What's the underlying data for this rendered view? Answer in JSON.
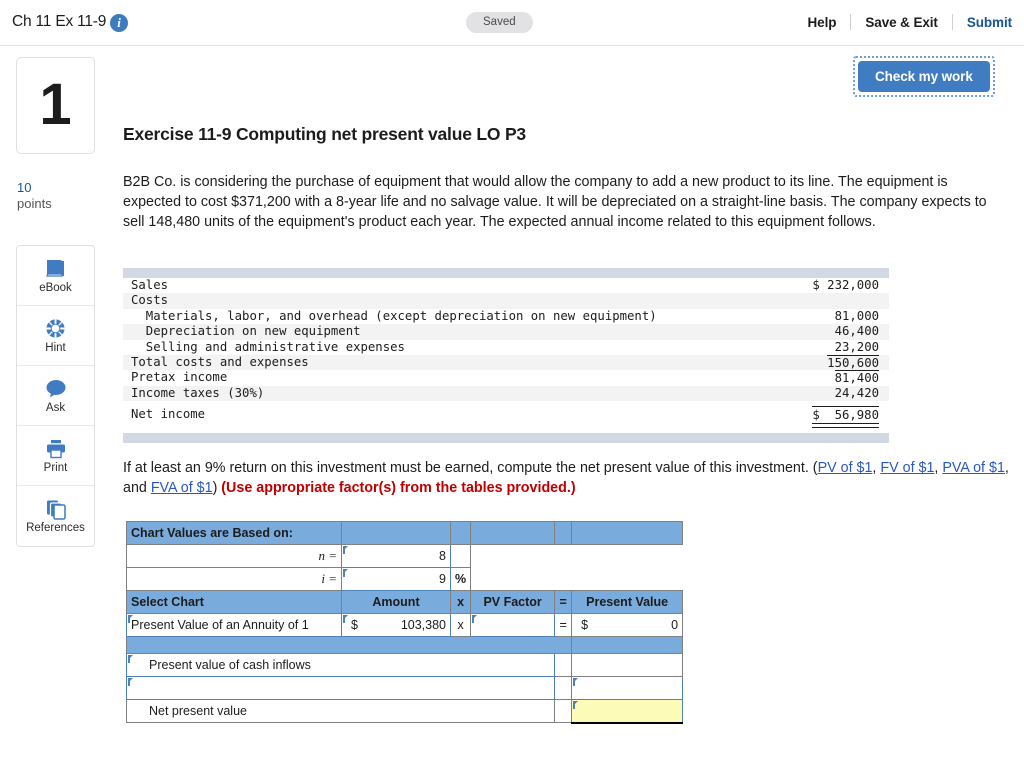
{
  "header": {
    "title": "Ch 11 Ex 11-9",
    "info_icon": "info-icon",
    "saved_status": "Saved",
    "help_label": "Help",
    "save_exit_label": "Save & Exit",
    "submit_label": "Submit"
  },
  "check_my_work": {
    "label": "Check my work"
  },
  "sidebar": {
    "question_number": "1",
    "points_value": "10",
    "points_label": "points",
    "tools": [
      {
        "label": "eBook",
        "icon": "book-icon"
      },
      {
        "label": "Hint",
        "icon": "lifebuoy-icon"
      },
      {
        "label": "Ask",
        "icon": "chat-bubble-icon"
      },
      {
        "label": "Print",
        "icon": "printer-icon"
      },
      {
        "label": "References",
        "icon": "copy-pages-icon"
      }
    ]
  },
  "exercise": {
    "title": "Exercise 11-9 Computing net present value LO P3",
    "intro": "B2B Co. is considering the purchase of equipment that would allow the company to add a new product to its line. The equipment is expected to cost $371,200 with a 8-year life and no salvage value. It will be depreciated on a straight-line basis. The company expects to sell 148,480 units of the equipment's product each year. The expected annual income related to this equipment follows."
  },
  "income_statement": {
    "rows": [
      {
        "label": "Sales",
        "amount": "$ 232,000"
      },
      {
        "label": "Costs",
        "amount": ""
      },
      {
        "label": "  Materials, labor, and overhead (except depreciation on new equipment)",
        "amount": "81,000"
      },
      {
        "label": "  Depreciation on new equipment",
        "amount": "46,400"
      },
      {
        "label": "  Selling and administrative expenses",
        "amount": "23,200"
      },
      {
        "label": "Total costs and expenses",
        "amount": "150,600"
      },
      {
        "label": "Pretax income",
        "amount": "81,400"
      },
      {
        "label": "Income taxes (30%)",
        "amount": "24,420"
      },
      {
        "label": "Net income",
        "amount": "$  56,980"
      }
    ]
  },
  "prompt": {
    "text_before": "If at least an 9% return on this investment must be earned, compute the net present value of this investment. (",
    "link1": "PV of $1",
    "sep1": ", ",
    "link2": "FV of $1",
    "sep2": ", ",
    "link3": "PVA of $1",
    "sep3": ", and ",
    "link4": "FVA of $1",
    "text_after": ") ",
    "red_note": "(Use appropriate factor(s) from the tables provided.)"
  },
  "answer_grid": {
    "chart_values_header": "Chart Values are Based on:",
    "n_label": "n =",
    "n_value": "8",
    "i_label": "i =",
    "i_value": "9",
    "percent_symbol": "%",
    "col_select_chart": "Select Chart",
    "col_amount": "Amount",
    "col_times": "x",
    "col_pv_factor": "PV Factor",
    "col_equals": "=",
    "col_present_value": "Present Value",
    "row_chart_name": "Present Value of an Annuity of 1",
    "row_amount_symbol": "$",
    "row_amount_value": "103,380",
    "row_times": "x",
    "row_pv_factor_value": "",
    "row_equals": "=",
    "row_pv_symbol": "$",
    "row_pv_value": "0",
    "label_pv_cash_inflows": "Present value of cash inflows",
    "label_blank_row": "",
    "label_net_present_value": "Net present value",
    "value_pv_cash_inflows": "",
    "value_blank_row": "",
    "value_net_present_value": ""
  },
  "colors": {
    "accent_blue": "#3f7cc2",
    "link_blue": "#2957c8",
    "grid_blue": "#7aabdd",
    "cell_border_blue": "#4f81bd",
    "answer_yellow": "#fcfcb8",
    "red_note": "#c00000"
  }
}
